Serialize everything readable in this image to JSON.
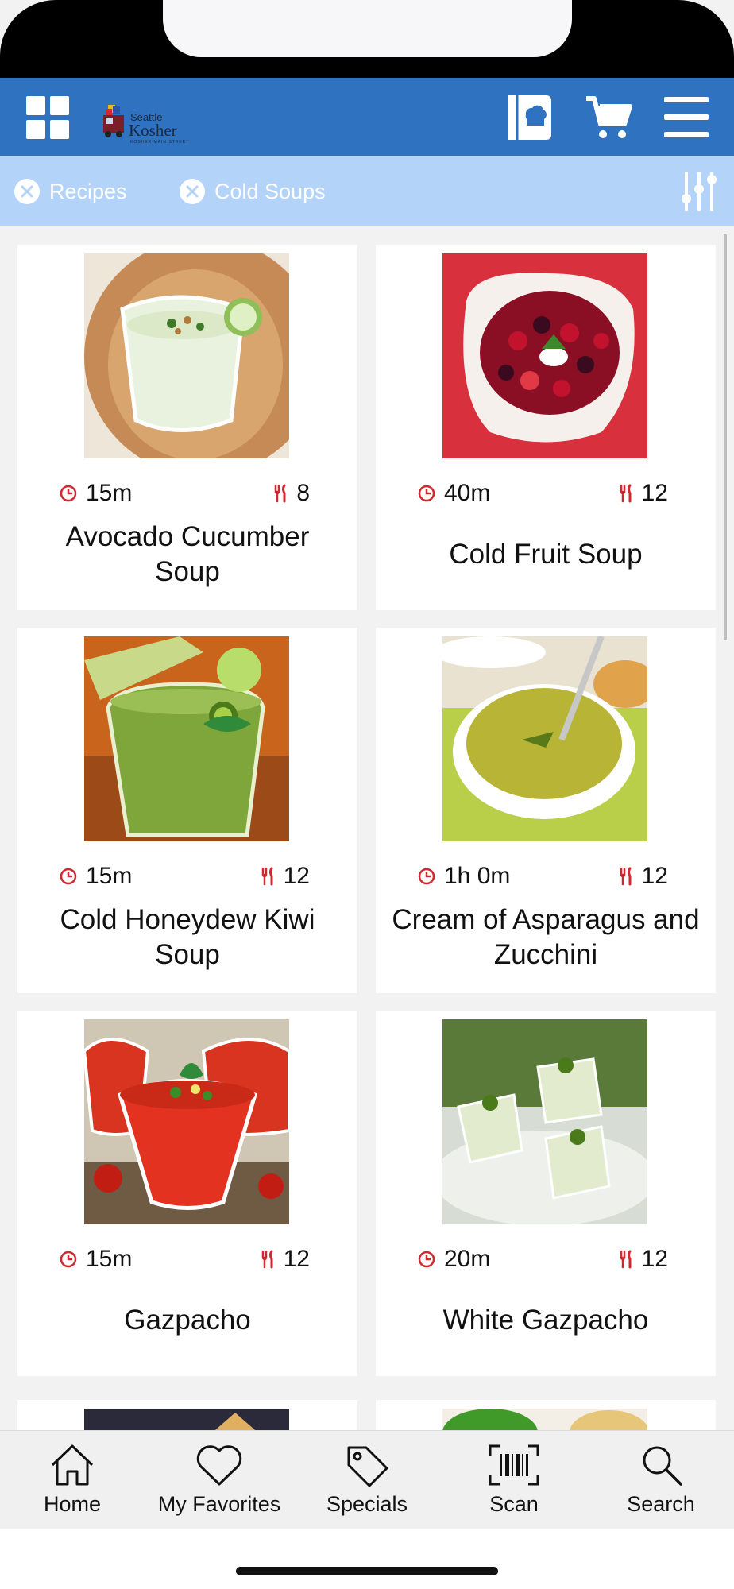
{
  "header": {
    "logo": {
      "line1": "Seattle",
      "line2": "Kosher",
      "tagline": "KOSHER MAIN STREET"
    },
    "icons": [
      "grid-icon",
      "chef-book-icon",
      "cart-icon",
      "menu-icon"
    ]
  },
  "filters": {
    "chips": [
      {
        "label": "Recipes"
      },
      {
        "label": "Cold Soups"
      }
    ]
  },
  "recipes": [
    {
      "title": "Avocado Cucumber Soup",
      "time": "15m",
      "servings": "8"
    },
    {
      "title": "Cold Fruit Soup",
      "time": "40m",
      "servings": "12"
    },
    {
      "title": "Cold Honeydew Kiwi Soup",
      "time": "15m",
      "servings": "12"
    },
    {
      "title": "Cream of Asparagus and Zucchini",
      "time": "1h 0m",
      "servings": "12"
    },
    {
      "title": "Gazpacho",
      "time": "15m",
      "servings": "12"
    },
    {
      "title": "White Gazpacho",
      "time": "20m",
      "servings": "12"
    }
  ],
  "tabbar": {
    "tabs": [
      {
        "label": "Home"
      },
      {
        "label": "My Favorites"
      },
      {
        "label": "Specials"
      },
      {
        "label": "Scan"
      },
      {
        "label": "Search"
      }
    ]
  },
  "colors": {
    "header": "#2f72bf",
    "filter_bar": "#b3d3f9",
    "accent_red": "#d1272f"
  }
}
